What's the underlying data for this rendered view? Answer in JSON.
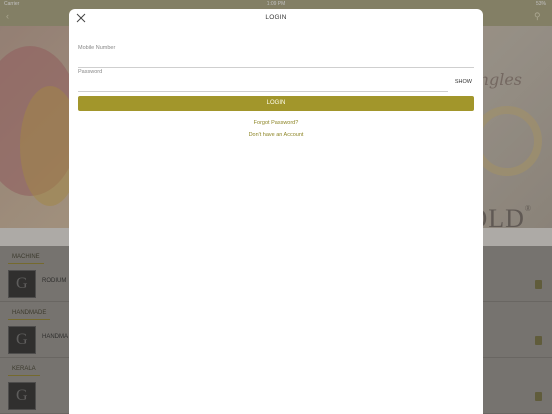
{
  "status_bar": {
    "carrier": "Carrier",
    "time": "1:09 PM",
    "battery": "53%"
  },
  "background": {
    "brand_script": "ngles",
    "brand_gold": "OLD",
    "brand_reg": "®",
    "sections": [
      {
        "title": "MACHINE",
        "rows": [
          {
            "label": "RODIUM"
          }
        ]
      },
      {
        "title": "HANDMADE",
        "rows": [
          {
            "label": "HANDMA"
          }
        ]
      },
      {
        "title": "KERALA",
        "rows": [
          {
            "label": ""
          }
        ]
      }
    ]
  },
  "modal": {
    "title": "LOGIN",
    "mobile": {
      "label": "Mobile Number",
      "value": ""
    },
    "password": {
      "label": "Password",
      "value": "",
      "show_label": "SHOW"
    },
    "login_label": "LOGIN",
    "forgot_label": "Forgot Password?",
    "signup_label": "Don't have an Account"
  },
  "colors": {
    "accent": "#a2962b",
    "link": "#8d8526",
    "nav": "#9e9a78"
  },
  "icons": {
    "close": "close-icon",
    "back": "back-icon",
    "filter": "filter-icon"
  }
}
